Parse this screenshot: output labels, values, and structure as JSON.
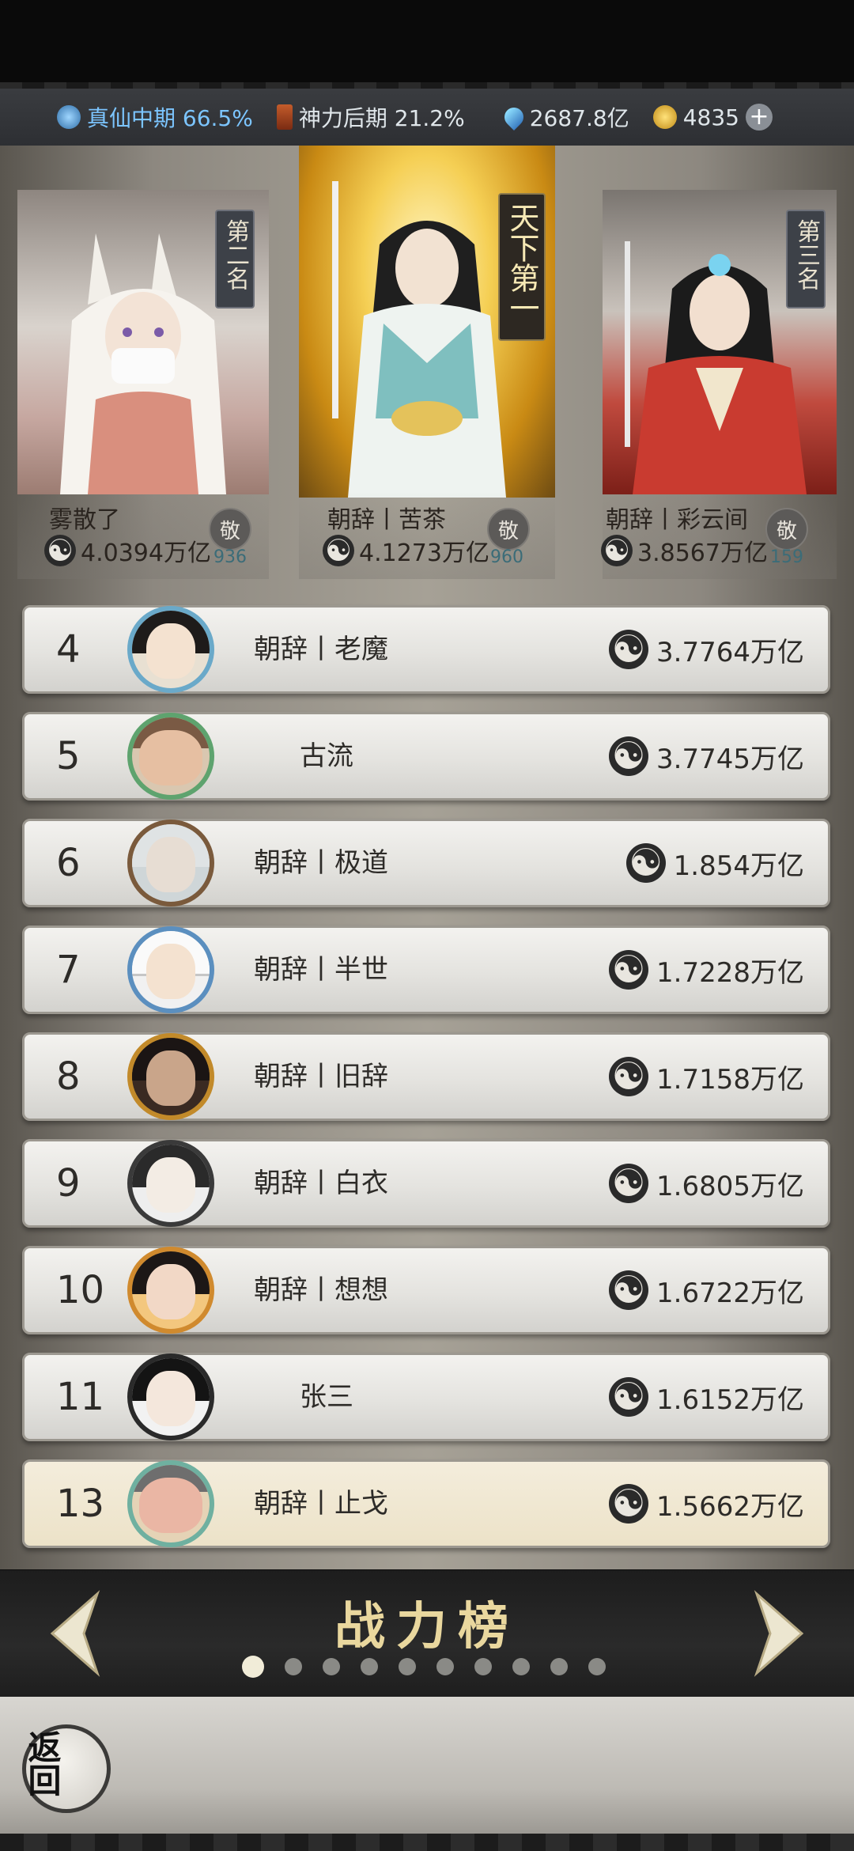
{
  "resources": [
    {
      "icon": "realm-icon",
      "text": "真仙中期 66.5%"
    },
    {
      "icon": "divine-power-icon",
      "text": "神力后期 21.2%"
    },
    {
      "icon": "spirit-crystal-icon",
      "text": "2687.8亿"
    },
    {
      "icon": "gold-coin-icon",
      "text": "4835"
    }
  ],
  "podium": {
    "first": {
      "tag": "天下第一",
      "name": "朝辞丨苦茶",
      "power": "4.1273万亿",
      "worship_label": "敬",
      "worship_count": "960"
    },
    "second": {
      "tag": "第二名",
      "name": "雾散了",
      "power": "4.0394万亿",
      "worship_label": "敬",
      "worship_count": "936"
    },
    "third": {
      "tag": "第三名",
      "name": "朝辞丨彩云间",
      "power": "3.8567万亿",
      "worship_label": "敬",
      "worship_count": "159"
    }
  },
  "rows": [
    {
      "rank": "4",
      "name": "朝辞丨老魔",
      "power": "3.7764万亿"
    },
    {
      "rank": "5",
      "name": "古流",
      "power": "3.7745万亿"
    },
    {
      "rank": "6",
      "name": "朝辞丨极道",
      "power": "1.854万亿"
    },
    {
      "rank": "7",
      "name": "朝辞丨半世",
      "power": "1.7228万亿"
    },
    {
      "rank": "8",
      "name": "朝辞丨旧辞",
      "power": "1.7158万亿"
    },
    {
      "rank": "9",
      "name": "朝辞丨白衣",
      "power": "1.6805万亿"
    },
    {
      "rank": "10",
      "name": "朝辞丨想想",
      "power": "1.6722万亿"
    },
    {
      "rank": "11",
      "name": "张三",
      "power": "1.6152万亿"
    },
    {
      "rank": "13",
      "name": "朝辞丨止戈",
      "power": "1.5662万亿"
    }
  ],
  "nav": {
    "title": "战力榜",
    "page_count": 10,
    "current_page": 1
  },
  "back_label": "返回",
  "colors": {
    "accent_gold": "#e9d79e",
    "value_blue": "#7cc5ff",
    "my_row": "#ece2c8"
  }
}
